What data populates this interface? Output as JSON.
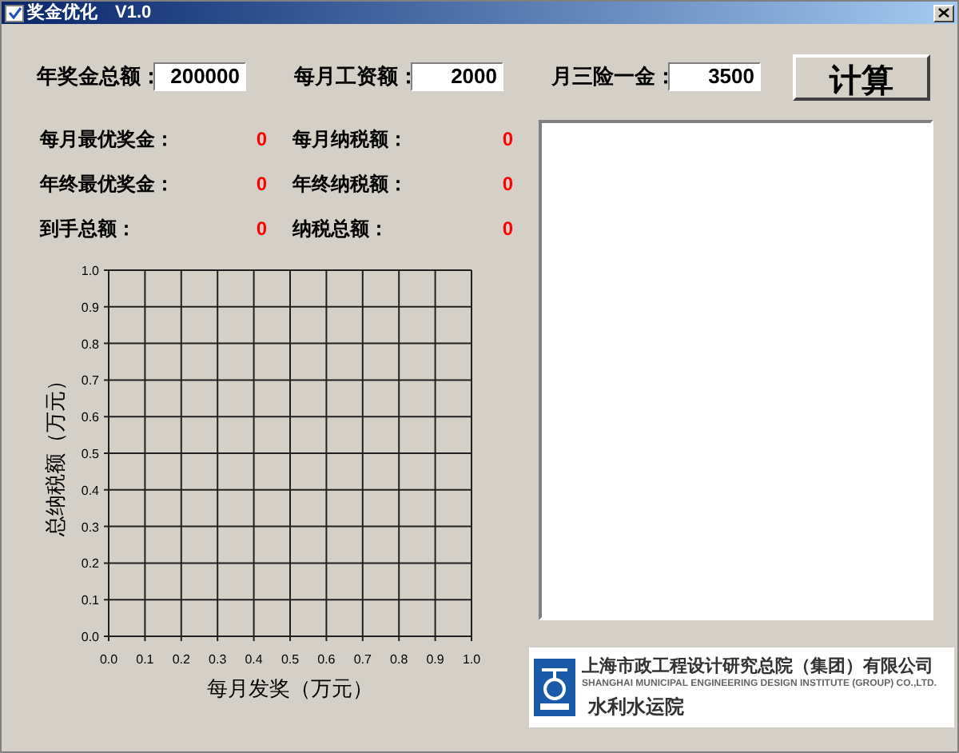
{
  "window": {
    "title": "奖金优化　V1.0"
  },
  "inputs": [
    {
      "label": "年奖金总额：",
      "value": "200000"
    },
    {
      "label": "每月工资额：",
      "value": "2000"
    },
    {
      "label": "月三险一金：",
      "value": "3500"
    }
  ],
  "button": {
    "label": "计算"
  },
  "results": [
    {
      "label": "每月最优奖金：",
      "value": "0"
    },
    {
      "label": "每月纳税额：",
      "value": "0"
    },
    {
      "label": "年终最优奖金：",
      "value": "0"
    },
    {
      "label": "年终纳税额：",
      "value": "0"
    },
    {
      "label": "到手总额：",
      "value": "0"
    },
    {
      "label": "纳税总额：",
      "value": "0"
    }
  ],
  "chart": {
    "chart_data": {
      "type": "line",
      "grid": true,
      "xlabel": "每月发奖（万元）",
      "ylabel": "总纳税额（万元）",
      "xlim": [
        0,
        1
      ],
      "ylim": [
        0,
        1
      ],
      "xticks": [
        {
          "value": 0,
          "label": "0.0"
        },
        {
          "value": 0.1,
          "label": "0.1"
        },
        {
          "value": 0.2,
          "label": "0.2"
        },
        {
          "value": 0.3,
          "label": "0.3"
        },
        {
          "value": 0.4,
          "label": "0.4"
        },
        {
          "value": 0.5,
          "label": "0.5"
        },
        {
          "value": 0.6,
          "label": "0.6"
        },
        {
          "value": 0.7,
          "label": "0.7"
        },
        {
          "value": 0.8,
          "label": "0.8"
        },
        {
          "value": 0.9,
          "label": "0.9"
        },
        {
          "value": 1,
          "label": "1.0"
        }
      ],
      "yticks": [
        {
          "value": 0,
          "label": "0.0"
        },
        {
          "value": 0.1,
          "label": "0.1"
        },
        {
          "value": 0.2,
          "label": "0.2"
        },
        {
          "value": 0.3,
          "label": "0.3"
        },
        {
          "value": 0.4,
          "label": "0.4"
        },
        {
          "value": 0.5,
          "label": "0.5"
        },
        {
          "value": 0.6,
          "label": "0.6"
        },
        {
          "value": 0.7,
          "label": "0.7"
        },
        {
          "value": 0.8,
          "label": "0.8"
        },
        {
          "value": 0.9,
          "label": "0.9"
        },
        {
          "value": 1,
          "label": "1.0"
        }
      ]
    }
  },
  "logo": {
    "name_cn": "上海市政工程设计研究总院（集团）有限公司",
    "name_en": "SHANGHAI MUNICIPAL ENGINEERING DESIGN INSTITUTE (GROUP) CO.,LTD.",
    "department": "水利水运院"
  }
}
